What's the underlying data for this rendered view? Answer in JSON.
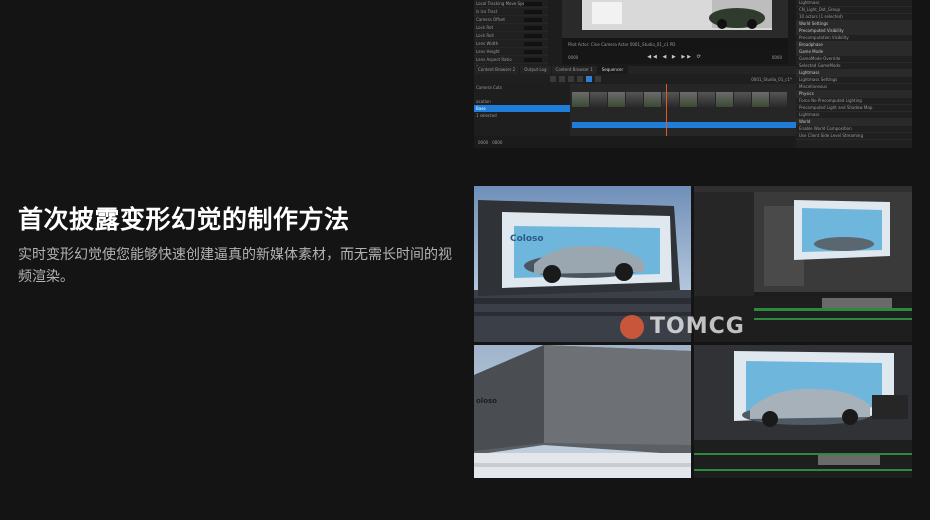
{
  "heading": "首次披露变形幻觉的制作方法",
  "description": "实时变形幻觉使您能够快速创建逼真的新媒体素材，而无需长时间的视频渲染。",
  "watermark": "TOMCG",
  "billboard_logo": "Coloso",
  "building_logo": "oloso",
  "editor": {
    "detail_rows": [
      "Local Tracking Move Speed",
      "Is Ice Tract",
      "Camera Offset",
      "Lock Rot",
      "Lock Roll",
      "Lens Width",
      "Lens Height",
      "Lens Aspect Ratio",
      "Settings",
      "Lens Length"
    ],
    "viewport_caption": "Pilot Actor: Cine Camera Actor  0001_Studio_01_c1 PD",
    "tabs": [
      "Content Browser 2",
      "Output Log",
      "Content Browser 1",
      "Sequencer"
    ],
    "outliner_rows": [
      "Camera Cuts",
      "",
      "ocation",
      "Base",
      "1 selected"
    ],
    "timeline_label": "0001_Studio_01_c1*",
    "frames": [
      "0000",
      "0000",
      "0000",
      "0000"
    ],
    "right_panel": [
      "Lightmass",
      "CN_Light_Dot_Group",
      "10 actors (1 selected)",
      "World Settings",
      "Precomputed Visibility",
      "Precomputation Visibility",
      "Broadphase",
      "Game Mode",
      "GameMode Override",
      "Selected GameMode",
      "Lightmass",
      "Lightmass Settings",
      "Miscellaneous",
      "Physics",
      "Force No Precomputed Lighting",
      "Precomputed Light and Shadow Map",
      "Lightmass",
      "World",
      "Enable World Composition",
      "Use Client Side Level Streaming"
    ]
  }
}
